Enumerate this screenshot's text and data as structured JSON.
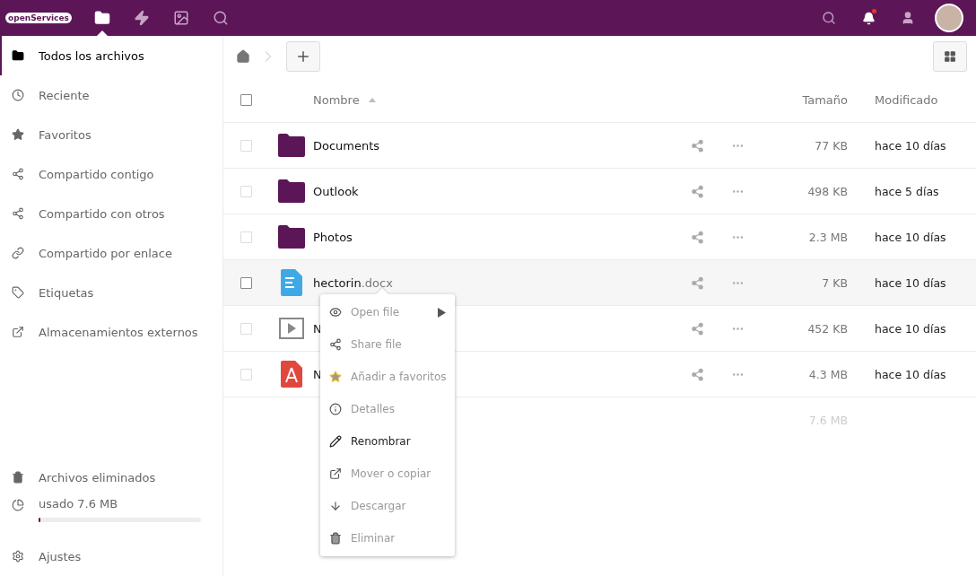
{
  "header": {
    "logo": "openServices",
    "apps": [
      {
        "selected": true
      },
      {
        "selected": false
      },
      {
        "selected": false
      },
      {
        "selected": false
      }
    ],
    "notification_unread": true
  },
  "sidebar": {
    "items": [
      {
        "label": "Todos los archivos",
        "selected": true
      },
      {
        "label": "Reciente",
        "selected": false
      },
      {
        "label": "Favoritos",
        "selected": false
      },
      {
        "label": "Compartido contigo",
        "selected": false
      },
      {
        "label": "Compartido con otros",
        "selected": false
      },
      {
        "label": "Compartido por enlace",
        "selected": false
      },
      {
        "label": "Etiquetas",
        "selected": false
      },
      {
        "label": "Almacenamientos externos",
        "selected": false
      }
    ],
    "trash": "Archivos eliminados",
    "quota": {
      "label": "usado 7.6 MB",
      "level": 0.01
    },
    "settings": "Ajustes"
  },
  "table": {
    "select_all_checked": false,
    "columns": [
      "Nombre",
      "Tamaño",
      "Modificado"
    ],
    "rows": [
      {
        "kind": "folder",
        "name": "Documents",
        "ext": "",
        "size": "77 KB",
        "modified": "hace 10 días",
        "highlighted": false,
        "checked": false
      },
      {
        "kind": "folder",
        "name": "Outlook",
        "ext": "",
        "size": "498 KB",
        "modified": "hace 5 días",
        "highlighted": false,
        "checked": false
      },
      {
        "kind": "folder",
        "name": "Photos",
        "ext": "",
        "size": "2.3 MB",
        "modified": "hace 10 días",
        "highlighted": false,
        "checked": false
      },
      {
        "kind": "document",
        "name": "hectorin",
        "ext": ".docx",
        "size": "7 KB",
        "modified": "hace 10 días",
        "highlighted": true,
        "checked": false
      },
      {
        "kind": "video",
        "name": "N",
        "ext": "",
        "size": "452 KB",
        "modified": "hace 10 días",
        "highlighted": false,
        "checked": false
      },
      {
        "kind": "pdf",
        "name": "N",
        "ext": "",
        "size": "4.3 MB",
        "modified": "hace 10 días",
        "highlighted": false,
        "checked": false
      }
    ],
    "total_size": "7.6 MB"
  },
  "context_menu": {
    "items": [
      {
        "label": "Open file",
        "submenu": true,
        "selected": false
      },
      {
        "label": "Share file",
        "submenu": false,
        "selected": false
      },
      {
        "label": "Añadir a favoritos",
        "submenu": false,
        "selected": false
      },
      {
        "label": "Detalles",
        "submenu": false,
        "selected": false
      },
      {
        "label": "Renombrar",
        "submenu": false,
        "selected": true
      },
      {
        "label": "Mover o copiar",
        "submenu": false,
        "selected": false
      },
      {
        "label": "Descargar",
        "submenu": false,
        "selected": false
      },
      {
        "label": "Eliminar",
        "submenu": false,
        "selected": false
      }
    ]
  }
}
